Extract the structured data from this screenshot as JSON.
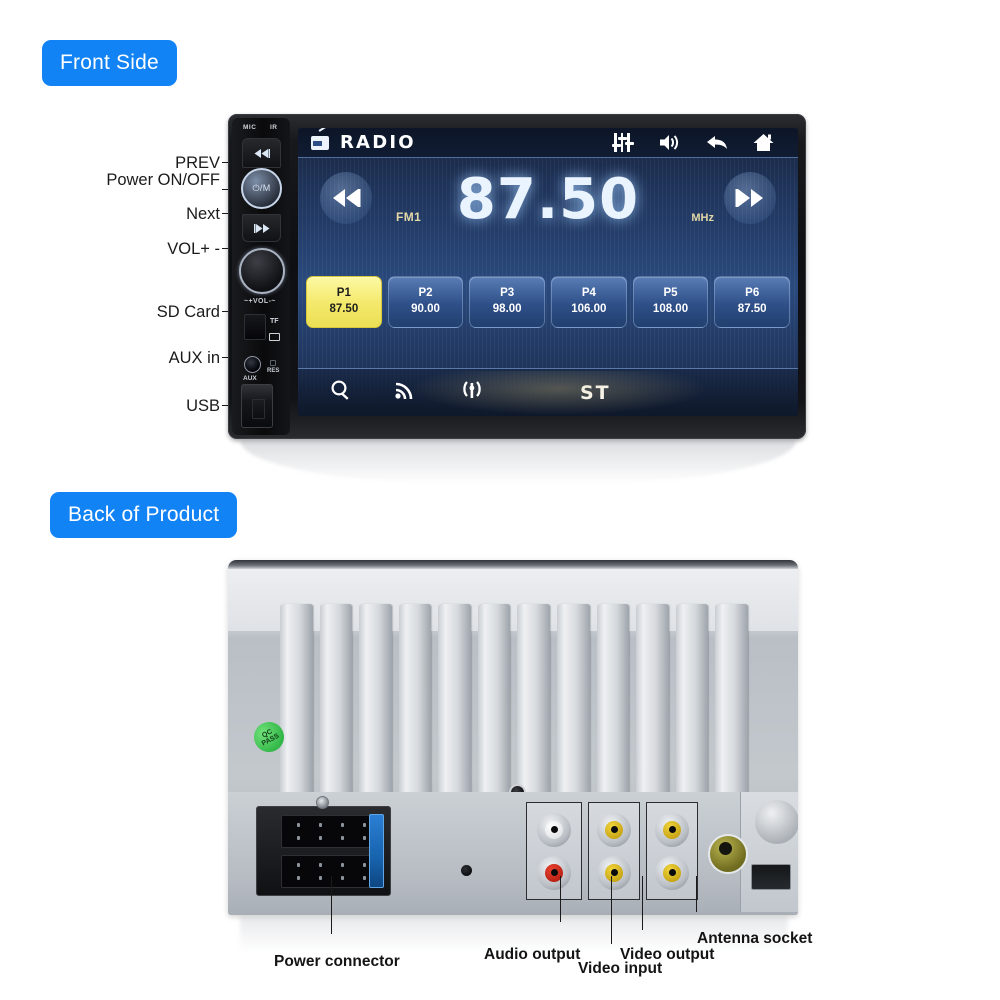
{
  "sections": {
    "front_badge": "Front Side",
    "back_badge": "Back of Product"
  },
  "front": {
    "bezel_labels": {
      "mic": "MIC",
      "ir": "IR"
    },
    "control_labels": {
      "power_button": "⏻/M",
      "volume_print": "~+VOL-~",
      "tf_print": "TF",
      "aux_print": "AUX",
      "res_print": "RES"
    },
    "callouts": [
      {
        "name": "prev",
        "text": "PREV"
      },
      {
        "name": "power-on-off",
        "text": "Power ON/OFF"
      },
      {
        "name": "next",
        "text": "Next"
      },
      {
        "name": "volume",
        "text": "VOL+ -"
      },
      {
        "name": "sd-card",
        "text": "SD Card"
      },
      {
        "name": "aux-in",
        "text": "AUX in"
      },
      {
        "name": "usb",
        "text": "USB"
      }
    ],
    "screen": {
      "topbar": {
        "source_label": "RADIO",
        "icons": [
          "radio-icon",
          "equalizer-icon",
          "volume-icon",
          "back-icon",
          "home-icon"
        ]
      },
      "band": "FM1",
      "frequency": "87.50",
      "unit": "MHz",
      "transport": {
        "prev": "rewind-icon",
        "next": "fast-forward-icon"
      },
      "presets": [
        {
          "name": "P1",
          "freq": "87.50",
          "active": true
        },
        {
          "name": "P2",
          "freq": "90.00",
          "active": false
        },
        {
          "name": "P3",
          "freq": "98.00",
          "active": false
        },
        {
          "name": "P4",
          "freq": "106.00",
          "active": false
        },
        {
          "name": "P5",
          "freq": "108.00",
          "active": false
        },
        {
          "name": "P6",
          "freq": "87.50",
          "active": false
        }
      ],
      "bottombar": {
        "icons": [
          "search-icon",
          "rss-icon",
          "antenna-icon"
        ],
        "stereo_label": "ST"
      }
    }
  },
  "back": {
    "qc_sticker": {
      "line1": "QC",
      "line2": "PASS"
    },
    "callouts": [
      {
        "name": "power-connector",
        "text": "Power connector"
      },
      {
        "name": "audio-output",
        "text": "Audio output"
      },
      {
        "name": "video-input",
        "text": "Video input"
      },
      {
        "name": "video-output",
        "text": "Video output"
      },
      {
        "name": "antenna-socket",
        "text": "Antenna socket"
      }
    ],
    "connectors": {
      "audio_output_jacks": [
        "white",
        "red"
      ],
      "video_input_jacks": [
        "yellow",
        "yellow"
      ],
      "video_output_jacks": [
        "yellow",
        "yellow"
      ],
      "antenna_jack": "din-antenna"
    },
    "heatsink_fin_count": 12
  },
  "colors": {
    "badge_blue": "#1283f5",
    "screen_blue": "#2a4a7e",
    "preset_active": "#f3e86a",
    "accent_tan": "#e3d9a8"
  }
}
